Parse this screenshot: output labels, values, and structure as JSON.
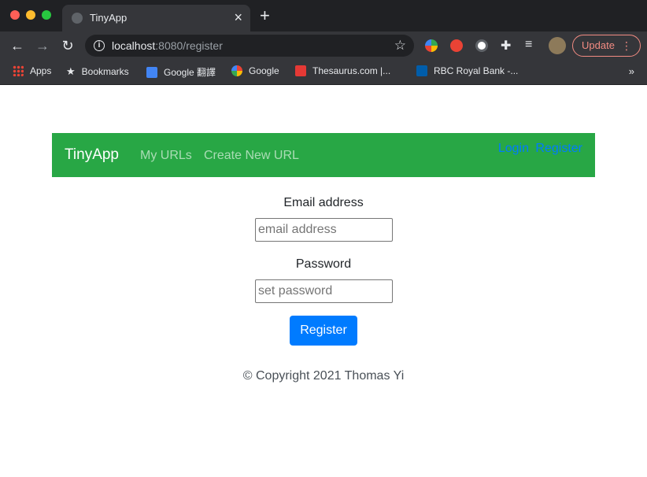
{
  "browser": {
    "tab_title": "TinyApp",
    "tab_close": "×",
    "new_tab": "+",
    "url_host": "localhost",
    "url_rest": ":8080/register",
    "update_label": "Update",
    "bookmarks": [
      {
        "label": "Apps",
        "icon": "apps-icon"
      },
      {
        "label": "Bookmarks",
        "icon": "star-icon"
      },
      {
        "label": "Google 翻譯",
        "icon": "google-translate-icon"
      },
      {
        "label": "Google",
        "icon": "google-icon"
      },
      {
        "label": "Thesaurus.com |...",
        "icon": "thesaurus-icon"
      },
      {
        "label": "RBC Royal Bank -...",
        "icon": "rbc-icon"
      }
    ],
    "bookmarks_more": "»"
  },
  "navbar": {
    "brand": "TinyApp",
    "links": [
      "My URLs",
      "Create New URL"
    ],
    "login": "Login",
    "register": "Register",
    "color": "#28a745"
  },
  "form": {
    "email_label": "Email address",
    "email_placeholder": "email address",
    "password_label": "Password",
    "password_placeholder": "set password",
    "submit_label": "Register",
    "button_color": "#007bff"
  },
  "footer": {
    "text": "© Copyright 2021 Thomas Yi"
  }
}
